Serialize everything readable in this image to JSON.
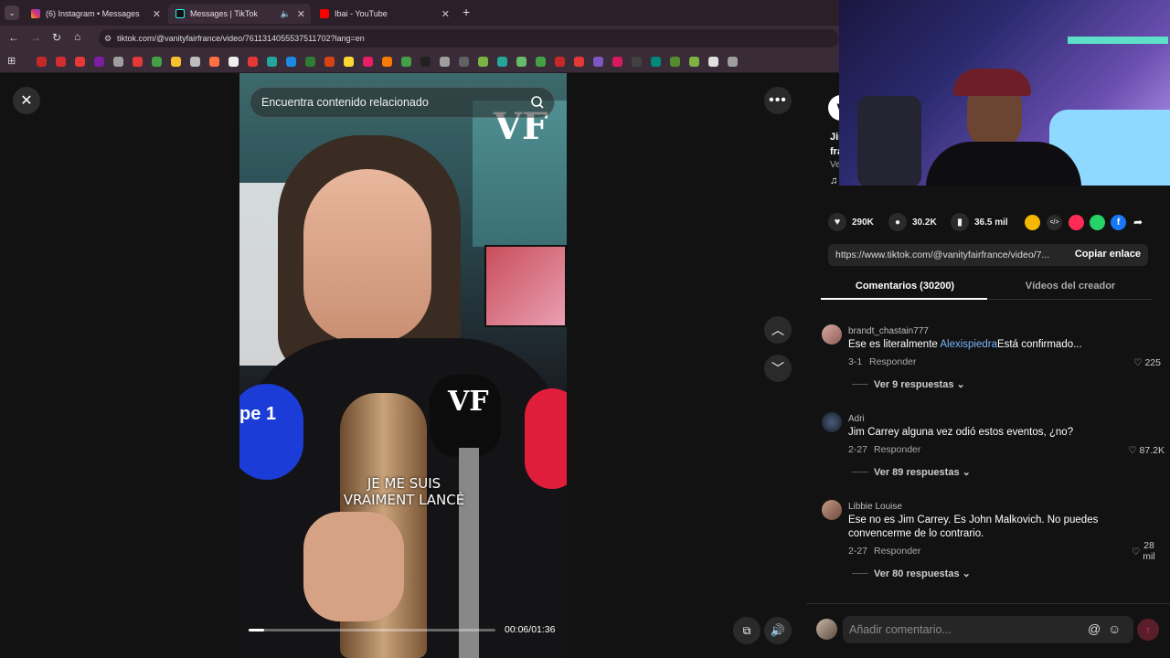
{
  "browser": {
    "tabs": [
      {
        "label": "(6) Instagram • Messages",
        "color": "#d6336c"
      },
      {
        "label": "Messages | TikTok",
        "color": "#111111"
      },
      {
        "label": "Ibai - YouTube",
        "color": "#ff0000"
      }
    ],
    "url": "tiktok.com/@vanityfairfrance/video/7611314055537511702?lang=en"
  },
  "video": {
    "search_placeholder": "Encuentra contenido relacionado",
    "caption": "JE ME SUIS\nVRAIMENT LANCÉ",
    "time": "00:06/01:36",
    "progress": 0.0625,
    "vf_logo": "VF"
  },
  "post": {
    "desc_line1": "Jim",
    "desc_line2": "fra",
    "desc_line3": "Ve",
    "likes": "290K",
    "comments": "30.2K",
    "saves": "36.5 mil",
    "link": "https://www.tiktok.com/@vanityfairfrance/video/7...",
    "copy_link": "Copiar enlace",
    "tab_comments": "Comentarios (30200)",
    "tab_creator": "Vídeos del creador"
  },
  "comments": [
    {
      "user": "brandt_chastain777",
      "text_pre": "Ese es literalmente ",
      "mention": "Alexispiedra",
      "text_post": "Está confirmado...",
      "date": "3-1",
      "reply": "Responder",
      "likes": "225",
      "replies": "Ver 9 respuestas"
    },
    {
      "user": "Adri",
      "text": "Jim Carrey alguna vez odió estos eventos, ¿no?",
      "date": "2-27",
      "reply": "Responder",
      "likes": "87.2K",
      "replies": "Ver 89 respuestas"
    },
    {
      "user": "Libbie Louise",
      "text": "Ese no es Jim Carrey. Es John Malkovich. No puedes convencerme de lo contrario.",
      "date": "2-27",
      "reply": "Responder",
      "likes": "28 mil",
      "replies": "Ver 80 respuestas"
    }
  ],
  "add_comment_placeholder": "Añadir comentario...",
  "colors": {
    "accent": "#fe2c55",
    "mention": "#78b7ff"
  }
}
